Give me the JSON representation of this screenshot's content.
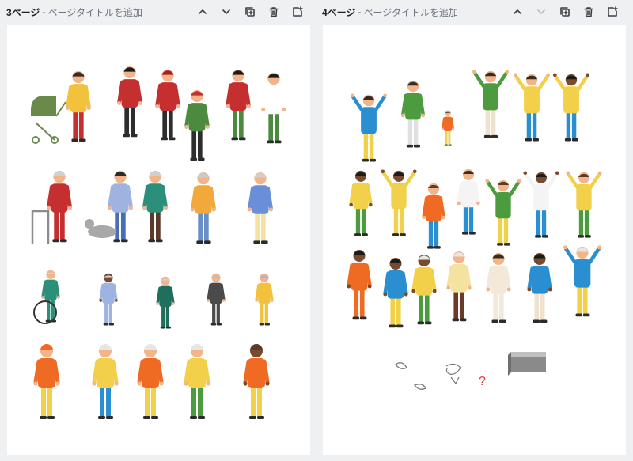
{
  "pages": [
    {
      "number_label": "3ページ",
      "separator": "-",
      "title_placeholder": "ページタイトルを追加",
      "tools": [
        "chevron-up-icon",
        "chevron-down-icon",
        "duplicate-icon",
        "trash-icon",
        "add-page-icon"
      ]
    },
    {
      "number_label": "4ページ",
      "separator": "-",
      "title_placeholder": "ページタイトルを追加",
      "tools": [
        "chevron-up-icon",
        "chevron-down-icon",
        "duplicate-icon",
        "trash-icon",
        "add-page-icon"
      ],
      "disabled_tools": [
        "chevron-down-icon"
      ]
    }
  ],
  "page3_illustrations": {
    "row1": [
      "mother-with-stroller",
      "family-red-coats",
      "parent-with-child",
      "couple-winter"
    ],
    "row2": [
      "elder-with-walker",
      "man-walking-dog",
      "elder-with-cane",
      "woman-with-handbag",
      "elder-with-walking-pole"
    ],
    "row3": [
      "person-in-wheelchair",
      "elder-with-box",
      "man-with-phone",
      "elder-with-camera",
      "elder-woman-glasses"
    ],
    "row4": [
      "man-thinking",
      "elder-with-cane-yellow",
      "elder-woman-orange",
      "man-shrugging",
      "woman-shrugging"
    ]
  },
  "page4_illustrations": {
    "row1": [
      "boy-jumping",
      "girl-in-green",
      "child-sitting",
      "woman-covering-ears",
      "man-hands-on-head",
      "man-hands-behind-head"
    ],
    "row2": [
      "girl-yellow",
      "girl-cheering",
      "boy-crouching",
      "boy-white-shirt",
      "kid-leaping",
      "woman-jumping",
      "girl-dancing"
    ],
    "row3": [
      "woman-orange-dress",
      "boy-arms-crossed",
      "elder-woman-green-skirt",
      "elder-man",
      "woman-white-dress",
      "woman-thinking",
      "elder-arms-raised"
    ],
    "row4": [
      "leaf-doodles",
      "swirl-doodle",
      "question-mark",
      "gray-box"
    ]
  },
  "colors": {
    "accent_red": "#c62f2f",
    "accent_yellow": "#f2c23c",
    "accent_blue": "#2a8fd0",
    "accent_green": "#4c8b3f",
    "accent_orange": "#ef6a22",
    "skin_dark": "#7a4a2e",
    "skin_light": "#f2b48a"
  }
}
